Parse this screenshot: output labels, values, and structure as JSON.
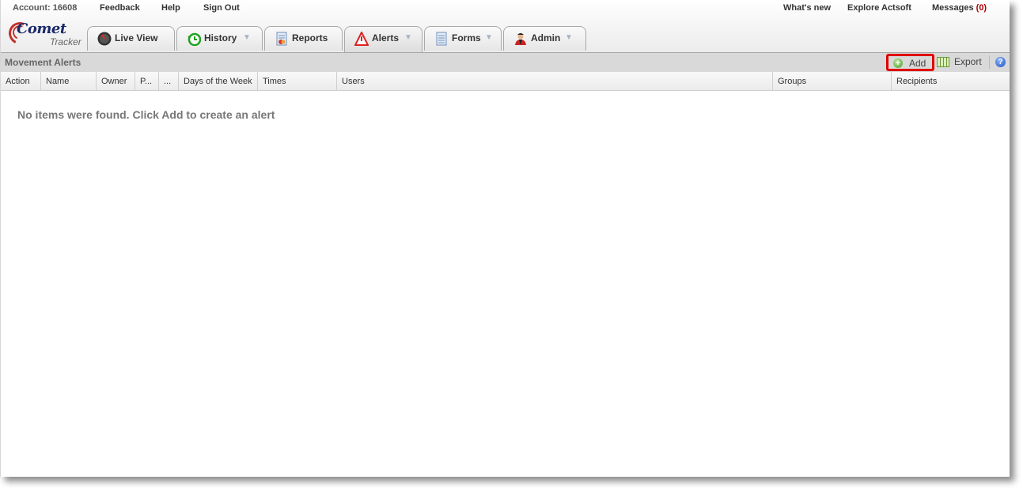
{
  "header": {
    "account": "Account: 16608",
    "links_left": [
      "Feedback",
      "Help",
      "Sign Out"
    ],
    "links_right": [
      "What's new",
      "Explore Actsoft"
    ],
    "messages_label": "Messages",
    "messages_count": "(0)"
  },
  "logo": {
    "brand": "Comet",
    "product": "Tracker"
  },
  "tabs": [
    {
      "label": "Live View",
      "icon": "speedometer-icon",
      "dropdown": false
    },
    {
      "label": "History",
      "icon": "clock-icon",
      "dropdown": true
    },
    {
      "label": "Reports",
      "icon": "report-icon",
      "dropdown": false
    },
    {
      "label": "Alerts",
      "icon": "warning-icon",
      "dropdown": true,
      "active": true
    },
    {
      "label": "Forms",
      "icon": "document-icon",
      "dropdown": true
    },
    {
      "label": "Admin",
      "icon": "user-admin-icon",
      "dropdown": true
    }
  ],
  "caret": "▼",
  "panel": {
    "title": "Movement Alerts",
    "add_label": "Add",
    "export_label": "Export",
    "help_glyph": "?"
  },
  "columns": [
    "Action",
    "Name",
    "Owner",
    "P...",
    "...",
    "Days of the Week",
    "Times",
    "Users",
    "Groups",
    "Recipients"
  ],
  "empty_message": "No items were found. Click Add to create an alert",
  "colors": {
    "highlight": "#e00000",
    "message_count": "#aa0000"
  }
}
